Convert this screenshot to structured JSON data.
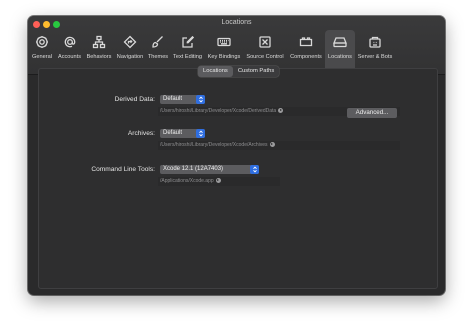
{
  "window": {
    "title": "Locations"
  },
  "toolbar": {
    "items": [
      {
        "label": "General",
        "icon": "gear-icon"
      },
      {
        "label": "Accounts",
        "icon": "at-icon"
      },
      {
        "label": "Behaviors",
        "icon": "behaviors-icon"
      },
      {
        "label": "Navigation",
        "icon": "navigation-icon"
      },
      {
        "label": "Themes",
        "icon": "brush-icon"
      },
      {
        "label": "Text Editing",
        "icon": "edit-icon"
      },
      {
        "label": "Key Bindings",
        "icon": "keyboard-icon"
      },
      {
        "label": "Source Control",
        "icon": "source-control-icon"
      },
      {
        "label": "Components",
        "icon": "components-icon"
      },
      {
        "label": "Locations",
        "icon": "drive-icon",
        "selected": true
      },
      {
        "label": "Server & Bots",
        "icon": "server-icon"
      }
    ]
  },
  "tabs": {
    "locations": "Locations",
    "custom_paths": "Custom Paths",
    "selected": "locations"
  },
  "derived_data": {
    "label": "Derived Data:",
    "value": "Default",
    "path": "/Users/hiroshi/Library/Developer/Xcode/DerivedData",
    "advanced_button": "Advanced..."
  },
  "archives": {
    "label": "Archives:",
    "value": "Default",
    "path": "/Users/hiroshi/Library/Developer/Xcode/Archives"
  },
  "command_line_tools": {
    "label": "Command Line Tools:",
    "value": "Xcode 12.1 (12A7403)",
    "path": "/Applications/Xcode.app"
  },
  "colors": {
    "accent": "#2f6ee0",
    "window_bg": "#2a2a2b"
  }
}
